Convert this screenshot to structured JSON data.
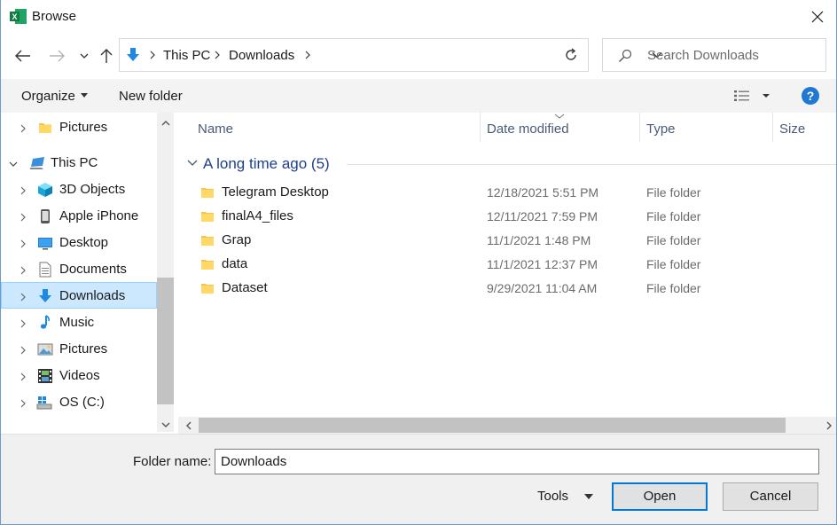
{
  "window": {
    "title": "Browse",
    "app_icon": "excel-icon",
    "accent_color": "#0078d7"
  },
  "address": {
    "crumbs": [
      "This PC",
      "Downloads"
    ],
    "search_placeholder": "Search Downloads"
  },
  "toolbar": {
    "organize_label": "Organize",
    "new_folder_label": "New folder",
    "help_label": "?"
  },
  "navpane": {
    "items": [
      {
        "label": "Pictures",
        "icon": "folder-icon",
        "level": 1,
        "expandable": true
      },
      {
        "label": "This PC",
        "icon": "computer-icon",
        "level": 0,
        "expanded": true
      },
      {
        "label": "3D Objects",
        "icon": "cube-icon",
        "level": 1,
        "expandable": true
      },
      {
        "label": "Apple iPhone",
        "icon": "phone-icon",
        "level": 1,
        "expandable": true
      },
      {
        "label": "Desktop",
        "icon": "desktop-icon",
        "level": 1,
        "expandable": true
      },
      {
        "label": "Documents",
        "icon": "documents-icon",
        "level": 1,
        "expandable": true
      },
      {
        "label": "Downloads",
        "icon": "download-arrow-icon",
        "level": 1,
        "expandable": true,
        "selected": true
      },
      {
        "label": "Music",
        "icon": "music-note-icon",
        "level": 1,
        "expandable": true
      },
      {
        "label": "Pictures",
        "icon": "pictures-icon",
        "level": 1,
        "expandable": true
      },
      {
        "label": "Videos",
        "icon": "film-icon",
        "level": 1,
        "expandable": true
      },
      {
        "label": "OS (C:)",
        "icon": "drive-icon",
        "level": 1,
        "expandable": true
      }
    ]
  },
  "columns": {
    "name": "Name",
    "date": "Date modified",
    "type": "Type",
    "size": "Size"
  },
  "group": {
    "title": "A long time ago (5)"
  },
  "files": [
    {
      "name": "Telegram Desktop",
      "date": "12/18/2021 5:51 PM",
      "type": "File folder"
    },
    {
      "name": "finalA4_files",
      "date": "12/11/2021 7:59 PM",
      "type": "File folder"
    },
    {
      "name": "Grap",
      "date": "11/1/2021 1:48 PM",
      "type": "File folder"
    },
    {
      "name": "data",
      "date": "11/1/2021 12:37 PM",
      "type": "File folder"
    },
    {
      "name": "Dataset",
      "date": "9/29/2021 11:04 AM",
      "type": "File folder"
    }
  ],
  "bottom": {
    "folder_name_label": "Folder name:",
    "folder_name_value": "Downloads",
    "tools_label": "Tools",
    "open_label": "Open",
    "cancel_label": "Cancel"
  }
}
